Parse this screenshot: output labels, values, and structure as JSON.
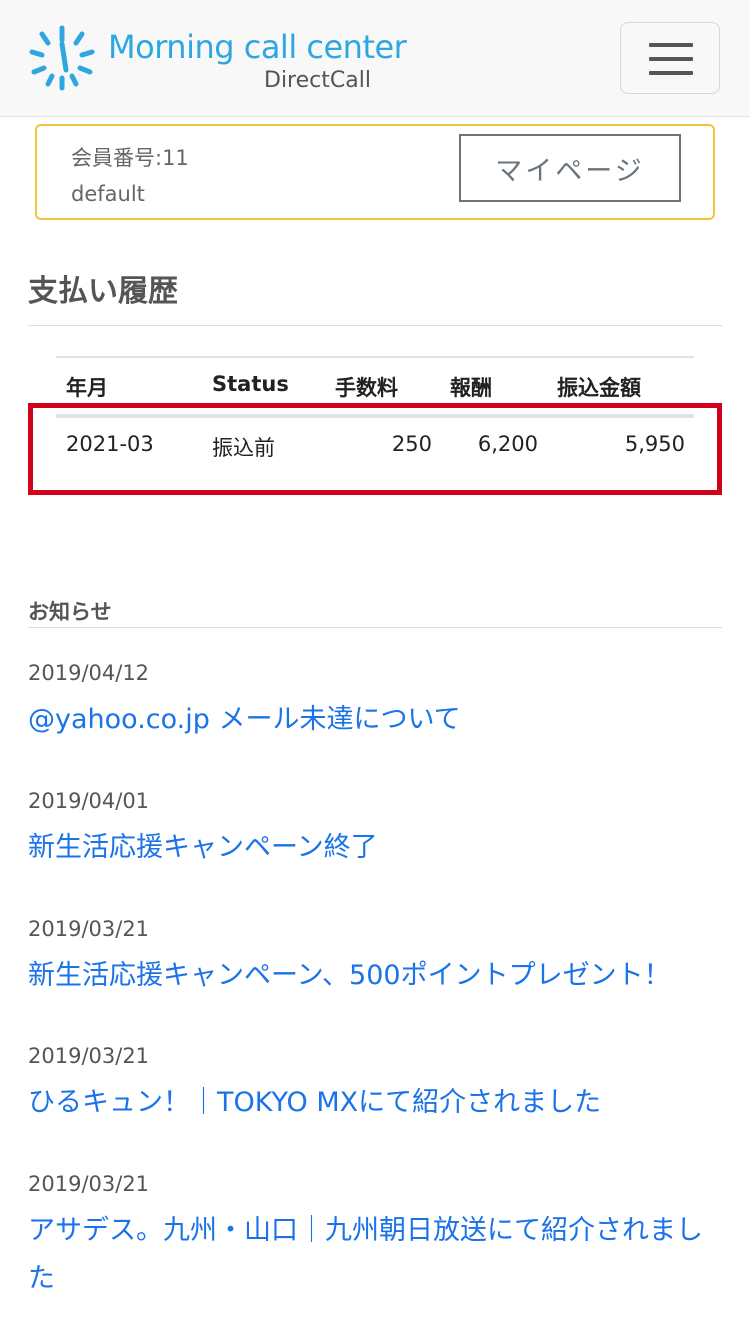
{
  "header": {
    "logo_title": "Morning call center",
    "logo_subtitle": "DirectCall",
    "brand_color": "#2ea7e0",
    "menu_icon": "hamburger-icon"
  },
  "member": {
    "number": "会員番号:11",
    "name": "default",
    "mypage_label": "マイページ"
  },
  "payment": {
    "title": "支払い履歴",
    "columns": [
      "年月",
      "Status",
      "手数料",
      "報酬",
      "振込金額"
    ],
    "rows": [
      {
        "month": "2021-03",
        "status": "振込前",
        "fee": "250",
        "reward": "6,200",
        "transfer": "5,950"
      }
    ],
    "highlight_color": "#d0021b"
  },
  "news": {
    "title": "お知らせ",
    "link_color": "#1a73e8",
    "items": [
      {
        "date": "2019/04/12",
        "text": "@yahoo.co.jp メール未達について"
      },
      {
        "date": "2019/04/01",
        "text": "新生活応援キャンペーン終了"
      },
      {
        "date": "2019/03/21",
        "text": "新生活応援キャンペーン、500ポイントプレゼント！"
      },
      {
        "date": "2019/03/21",
        "text": "ひるキュン！｜TOKYO MXにて紹介されました"
      },
      {
        "date": "2019/03/21",
        "text": "アサデス。九州・山口｜九州朝日放送にて紹介されました"
      }
    ]
  }
}
